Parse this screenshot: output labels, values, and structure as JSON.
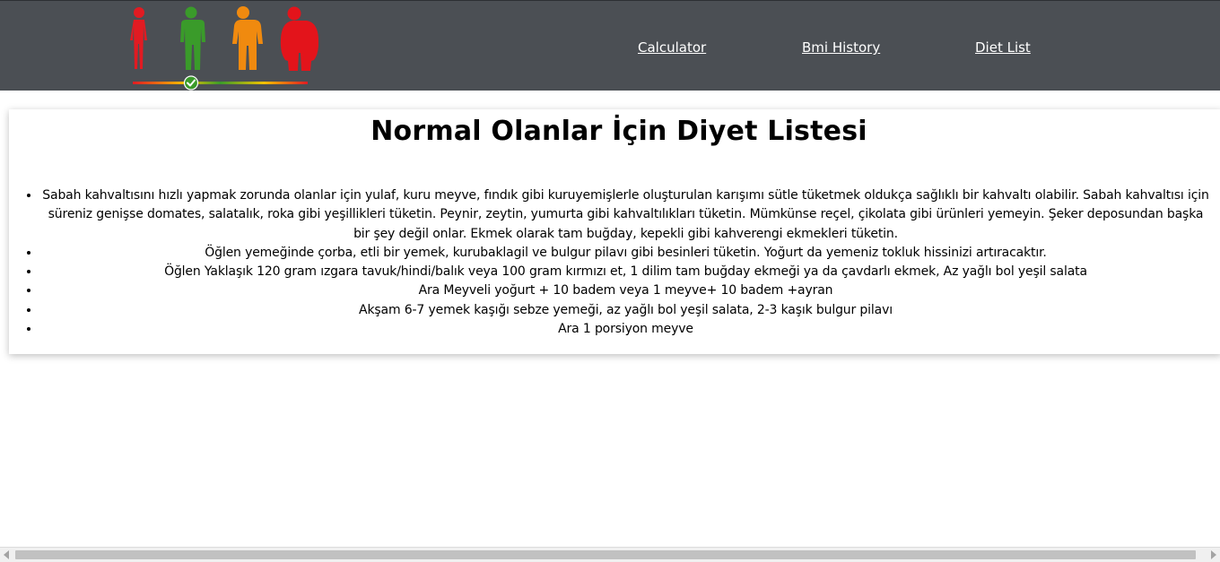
{
  "nav": {
    "logo_icon": "bmi-body-figures-logo",
    "links": [
      "Calculator",
      "Bmi History",
      "Diet List"
    ]
  },
  "colors": {
    "navbar": "#4b4f54",
    "fig_underweight": "#e11b22",
    "fig_normal": "#3a9b2a",
    "fig_overweight": "#f08a0f",
    "fig_obese": "#e3141b"
  },
  "main": {
    "title": "Normal Olanlar İçin Diyet Listesi",
    "items": [
      "Sabah kahvaltısını hızlı yapmak zorunda olanlar için yulaf, kuru meyve, fındık gibi kuruyemişlerle oluşturulan karışımı sütle tüketmek oldukça sağlıklı bir kahvaltı olabilir. Sabah kahvaltısı için süreniz genişse domates, salatalık, roka gibi yeşillikleri tüketin. Peynir, zeytin, yumurta gibi kahvaltılıkları tüketin. Mümkünse reçel, çikolata gibi ürünleri yemeyin. Şeker deposundan başka bir şey değil onlar. Ekmek olarak tam buğday, kepekli gibi kahverengi ekmekleri tüketin.",
      "Öğlen yemeğinde çorba, etli bir yemek, kurubaklagil ve bulgur pilavı gibi besinleri tüketin. Yoğurt da yemeniz tokluk hissinizi artıracaktır.",
      "Öğlen Yaklaşık 120 gram ızgara tavuk/hindi/balık veya 100 gram kırmızı et, 1 dilim tam buğday ekmeği ya da çavdarlı ekmek, Az yağlı bol yeşil salata",
      "Ara Meyveli yoğurt + 10 badem veya 1 meyve+ 10 badem +ayran",
      "Akşam 6-7 yemek kaşığı sebze yemeği, az yağlı bol yeşil salata, 2-3 kaşık bulgur pilavı",
      "Ara 1 porsiyon meyve"
    ]
  }
}
